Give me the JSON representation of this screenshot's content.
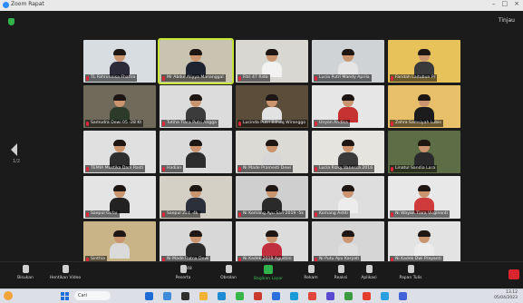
{
  "window": {
    "title": "Zoom Rapat"
  },
  "meeting": {
    "view_label": "Tinjau",
    "page_indicator": "1/2",
    "participants": [
      {
        "name": "TL Fahrunnisa Fhafira",
        "bg": "#d8dde2",
        "shirt": "#2b2b3a",
        "active": false
      },
      {
        "name": "Mr Abdul Aliyya Mananggal",
        "bg": "#c9c3b2",
        "shirt": "#1f2530",
        "active": true
      },
      {
        "name": "Fitri 47 Rida",
        "bg": "#d9d7d2",
        "shirt": "#f2f2f2",
        "active": false
      },
      {
        "name": "Lucia Putri Mandy Aprila",
        "bg": "#cfd3d6",
        "shirt": "#e5e5e5",
        "active": false
      },
      {
        "name": "Faridah Laitubun Pr",
        "bg": "#e7c15a",
        "shirt": "#3a3a3a",
        "active": false
      },
      {
        "name": "Samudra Dewi 05 -28 Kt",
        "bg": "#6f6a5a",
        "shirt": "#2c3a2a",
        "active": false
      },
      {
        "name": "Tutiha Tiara Putri Angga",
        "bg": "#dcdcdc",
        "shirt": "#3b3b3b",
        "active": false
      },
      {
        "name": "Lucinda Putri Bilhaq Wiranggo",
        "bg": "#5b4d3a",
        "shirt": "#e2e2e2",
        "active": false
      },
      {
        "name": "Unyon Andika",
        "bg": "#e6e6e6",
        "shirt": "#c63232",
        "active": false
      },
      {
        "name": "Zahra Samsiyah Lubis",
        "bg": "#e9c06a",
        "shirt": "#1c1c1c",
        "active": false
      },
      {
        "name": "TEMIA Mustika Dani Rasti",
        "bg": "#e0e0e0",
        "shirt": "#2f2f2f",
        "active": false
      },
      {
        "name": "Hadian",
        "bg": "#dadada",
        "shirt": "#2c2c2c",
        "active": false
      },
      {
        "name": "Ni Made Pramesti Dewi",
        "bg": "#dcdad5",
        "shirt": "#d7d7d7",
        "active": false
      },
      {
        "name": "Lucia Rizky Vanessa 2016",
        "bg": "#e6e4de",
        "shirt": "#3a3a3a",
        "active": false
      },
      {
        "name": "Linatul Sandia Lara",
        "bg": "#5d6d45",
        "shirt": "#2a2a2a",
        "active": false
      },
      {
        "name": "Saepul Gofar",
        "bg": "#e4e4e4",
        "shirt": "#222222",
        "active": false
      },
      {
        "name": "Saepul 224 -4k",
        "bg": "#d4d0c6",
        "shirt": "#2a2f3a",
        "active": false
      },
      {
        "name": "Ni Komang Ayu Sari 2019 -5k",
        "bg": "#cfcfcf",
        "shirt": "#2a2a2a",
        "active": false
      },
      {
        "name": "Komang Astiti",
        "bg": "#dedede",
        "shirt": "#ececec",
        "active": false
      },
      {
        "name": "Ni Wayan Tiara Virginanti",
        "bg": "#e8e8e8",
        "shirt": "#cf3a3a",
        "active": false
      },
      {
        "name": "Sinthia",
        "bg": "#c9b487",
        "shirt": "#dadada",
        "active": false
      },
      {
        "name": "Ni Made Ratna Dewi",
        "bg": "#d8d8d8",
        "shirt": "#2b2b2b",
        "active": false
      },
      {
        "name": "Ni Kadek 2019 Agustini",
        "bg": "#dcdcdc",
        "shirt": "#c22f3e",
        "active": false
      },
      {
        "name": "Ni Putu Ayu Karyati",
        "bg": "#d6d6d6",
        "shirt": "#dedede",
        "active": false
      },
      {
        "name": "Ni Kadek Dwi Prayanti",
        "bg": "#e3e3e3",
        "shirt": "#ececec",
        "active": false
      }
    ]
  },
  "toolbar": {
    "items": [
      {
        "label": "Bisukan",
        "icon": "microphone-icon"
      },
      {
        "label": "Hentikan Video",
        "icon": "camera-icon"
      },
      {
        "label": "Peserta",
        "icon": "participants-icon",
        "count": "48"
      },
      {
        "label": "Obrolan",
        "icon": "chat-icon"
      },
      {
        "label": "Bagikan Layar",
        "icon": "share-screen-icon",
        "accent": "#2fb34a"
      },
      {
        "label": "Rekam",
        "icon": "record-icon"
      },
      {
        "label": "Reaksi",
        "icon": "reaction-icon"
      },
      {
        "label": "Aplikasi",
        "icon": "apps-icon"
      },
      {
        "label": "Papan Tulis",
        "icon": "whiteboard-icon"
      }
    ],
    "leave_color": "#d9262e"
  },
  "taskbar": {
    "search_label": "Cari",
    "clock_time": "13.12",
    "clock_date": "05/04/2023",
    "apps": [
      "#1f6bd6",
      "#3d8bd9",
      "#2f2f2f",
      "#f2b233",
      "#1e8bd2",
      "#3ab54a",
      "#c9392e",
      "#2a6fdb",
      "#1a9bd7",
      "#e0473a",
      "#5a4ad1",
      "#3c9b3f",
      "#e23e2b",
      "#2aa0e0",
      "#4263d8"
    ]
  }
}
